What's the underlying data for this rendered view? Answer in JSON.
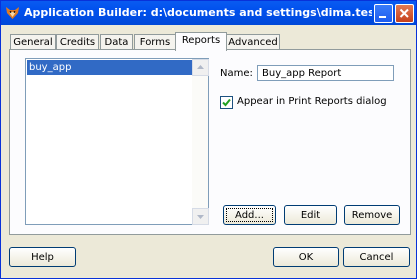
{
  "window": {
    "title": "Application Builder: d:\\documents and settings\\dima.testing\\мои док..."
  },
  "tabs": [
    {
      "label": "General"
    },
    {
      "label": "Credits"
    },
    {
      "label": "Data"
    },
    {
      "label": "Forms"
    },
    {
      "label": "Reports",
      "active": true
    },
    {
      "label": "Advanced"
    }
  ],
  "reports": {
    "list_items": [
      "buy_app"
    ],
    "selected_index": 0,
    "name_label": "Name:",
    "name_value": "Buy_app Report",
    "appear_label": "Appear in Print Reports dialog",
    "appear_checked": true,
    "add_button": "Add...",
    "edit_button": "Edit",
    "remove_button": "Remove"
  },
  "footer": {
    "help_button": "Help",
    "ok_button": "OK",
    "cancel_button": "Cancel"
  },
  "colors": {
    "title_bar": "#0a5bf0",
    "selection": "#316ac5",
    "dialog_bg": "#ece9d8"
  }
}
